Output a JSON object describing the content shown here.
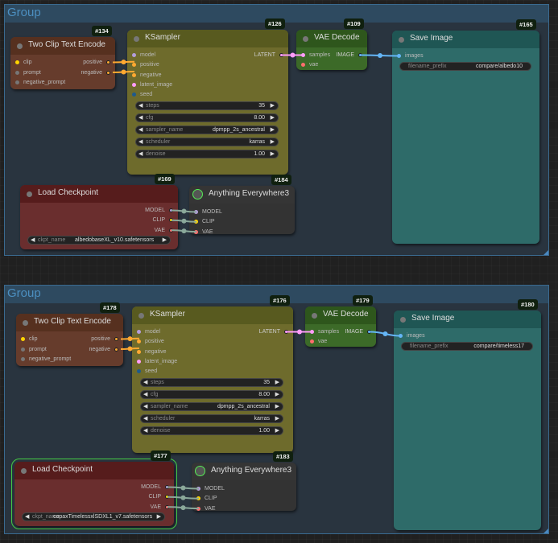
{
  "groups": [
    {
      "title": "Group",
      "nodes": {
        "two_clip": {
          "id": "#134",
          "title": "Two Clip Text Encode",
          "inputs": [
            "clip",
            "prompt",
            "negative_prompt"
          ],
          "outputs": [
            "positive",
            "negative"
          ]
        },
        "ksampler": {
          "id": "#126",
          "title": "KSampler",
          "inputs": [
            "model",
            "positive",
            "negative",
            "latent_image",
            "seed"
          ],
          "output": "LATENT",
          "widgets": [
            {
              "label": "steps",
              "value": "35"
            },
            {
              "label": "cfg",
              "value": "8.00"
            },
            {
              "label": "sampler_name",
              "value": "dpmpp_2s_ancestral"
            },
            {
              "label": "scheduler",
              "value": "karras"
            },
            {
              "label": "denoise",
              "value": "1.00"
            }
          ]
        },
        "vae_decode": {
          "id": "#109",
          "title": "VAE Decode",
          "inputs": [
            "samples",
            "vae"
          ],
          "output": "IMAGE"
        },
        "save_image": {
          "id": "#165",
          "title": "Save Image",
          "input": "images",
          "widget": {
            "label": "filename_prefix",
            "value": "compare/albedo10"
          }
        },
        "load_ckpt": {
          "id": "#169",
          "title": "Load Checkpoint",
          "outputs": [
            "MODEL",
            "CLIP",
            "VAE"
          ],
          "widget": {
            "label": "ckpt_name",
            "value": "albedobaseXL_v10.safetensors"
          }
        },
        "anything": {
          "id": "#184",
          "title": "Anything Everywhere3",
          "inputs": [
            "MODEL",
            "CLIP",
            "VAE"
          ]
        }
      }
    },
    {
      "title": "Group",
      "nodes": {
        "two_clip": {
          "id": "#178",
          "title": "Two Clip Text Encode",
          "inputs": [
            "clip",
            "prompt",
            "negative_prompt"
          ],
          "outputs": [
            "positive",
            "negative"
          ]
        },
        "ksampler": {
          "id": "#176",
          "title": "KSampler",
          "inputs": [
            "model",
            "positive",
            "negative",
            "latent_image",
            "seed"
          ],
          "output": "LATENT",
          "widgets": [
            {
              "label": "steps",
              "value": "35"
            },
            {
              "label": "cfg",
              "value": "8.00"
            },
            {
              "label": "sampler_name",
              "value": "dpmpp_2s_ancestral"
            },
            {
              "label": "scheduler",
              "value": "karras"
            },
            {
              "label": "denoise",
              "value": "1.00"
            }
          ]
        },
        "vae_decode": {
          "id": "#179",
          "title": "VAE Decode",
          "inputs": [
            "samples",
            "vae"
          ],
          "output": "IMAGE"
        },
        "save_image": {
          "id": "#180",
          "title": "Save Image",
          "input": "images",
          "widget": {
            "label": "filename_prefix",
            "value": "compare/timeless17"
          }
        },
        "load_ckpt": {
          "id": "#177",
          "title": "Load Checkpoint",
          "outputs": [
            "MODEL",
            "CLIP",
            "VAE"
          ],
          "widget": {
            "label": "ckpt_name",
            "value": "copaxTimelessxlSDXL1_v7.safetensors"
          }
        },
        "anything": {
          "id": "#183",
          "title": "Anything Everywhere3",
          "inputs": [
            "MODEL",
            "CLIP",
            "VAE"
          ]
        }
      }
    }
  ],
  "colors": {
    "clip": "#ffd500",
    "conditioning": "#ffa931",
    "model": "#b39ddb",
    "latent": "#ff9cf9",
    "int": "#1e5a8c",
    "vae": "#ff6e6e",
    "image": "#64b5f6",
    "string": "#777777",
    "link_gray": "#8aa89a",
    "selected": "#44cc44"
  }
}
